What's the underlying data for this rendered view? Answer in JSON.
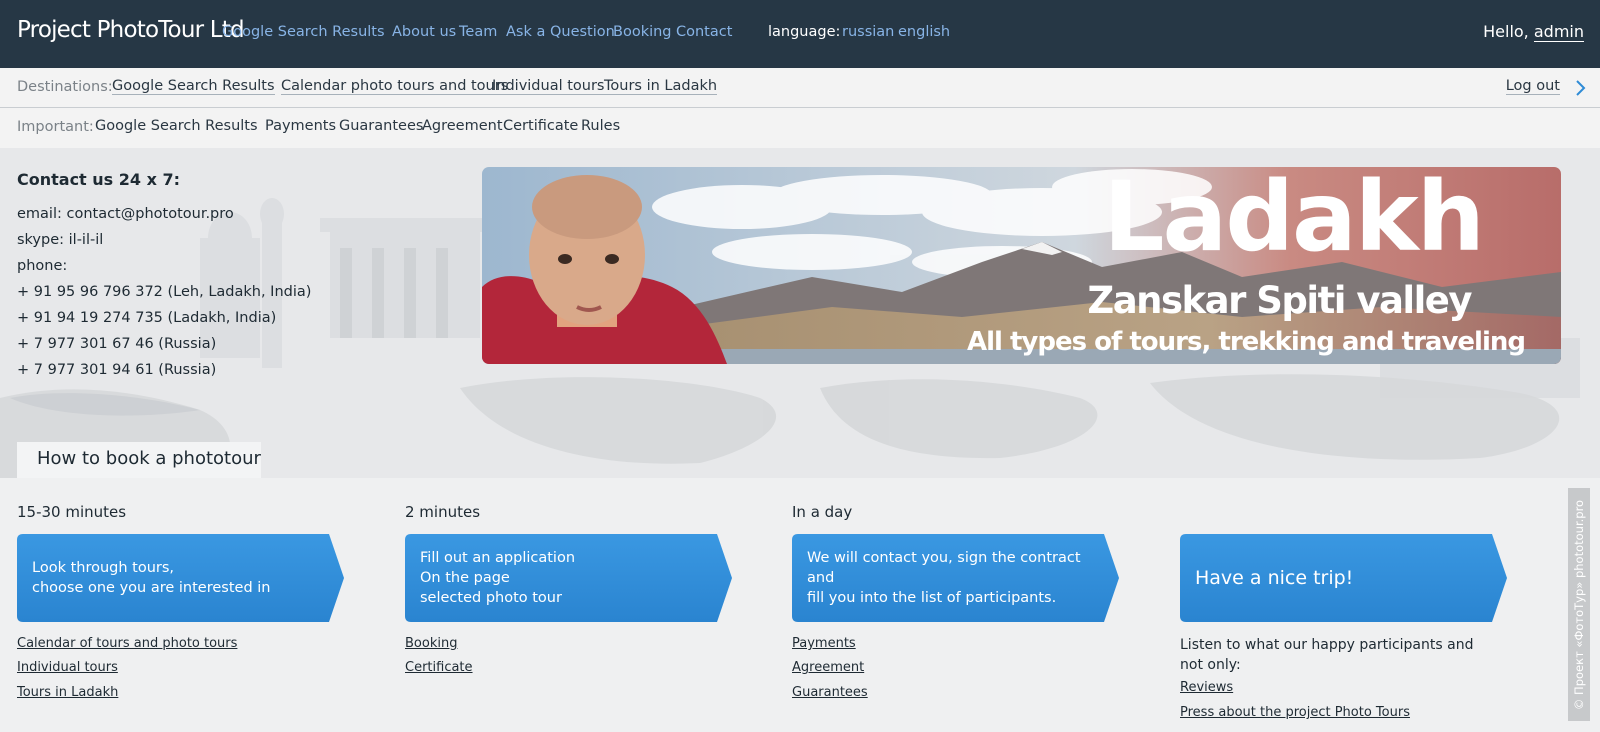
{
  "topbar": {
    "brand": "Project PhotoTour Ltd",
    "nav": [
      "Google Search Results",
      "About us",
      "Team",
      "Ask a Question",
      "Booking",
      "Contact"
    ],
    "language_label": "language:",
    "languages": [
      "russian",
      "english"
    ],
    "hello_prefix": "Hello,",
    "user": "admin"
  },
  "destinations": {
    "label": "Destinations:",
    "links": [
      "Google Search Results",
      "Calendar photo tours and tours",
      "Individual tours",
      "Tours in Ladakh"
    ],
    "logout": "Log out"
  },
  "important": {
    "label": "Important:",
    "links": [
      "Google Search Results",
      "Payments",
      "Guarantees",
      "Agreement",
      "Certificate",
      "Rules"
    ]
  },
  "contact": {
    "title": "Contact us 24 x 7:",
    "lines": [
      "email: contact@phototour.pro",
      "skype: il-il-il",
      "phone:",
      "+ 91 95 96 796 372 (Leh, Ladakh, India)",
      "+ 91 94 19 274 735 (Ladakh, India)",
      "+ 7 977 301 67 46 (Russia)",
      "+ 7 977 301 94 61 (Russia)"
    ]
  },
  "banner": {
    "title": "Ladakh",
    "subtitle": "Zanskar Spiti valley",
    "tagline": "All types of tours, trekking and traveling"
  },
  "booking": {
    "heading": "How to book a phototour",
    "steps": [
      {
        "time": "15-30 minutes",
        "text_lines": [
          "Look through tours,",
          "choose one you are interested in"
        ],
        "links": [
          "Calendar of tours and photo tours",
          "Individual tours",
          "Tours in Ladakh"
        ]
      },
      {
        "time": "2 minutes",
        "text_lines": [
          "Fill out an application",
          "On the page",
          "selected photo tour"
        ],
        "links": [
          "Booking",
          "Certificate"
        ]
      },
      {
        "time": "In a day",
        "text_lines": [
          "We will contact you, sign the contract and",
          "fill you into the list of participants."
        ],
        "links": [
          "Payments",
          "Agreement",
          "Guarantees"
        ]
      },
      {
        "time": "",
        "text_lines": [
          "Have a nice trip!"
        ],
        "note": "Listen to what our happy participants and not only:",
        "links": [
          "Reviews",
          "Press about the project Photo Tours"
        ]
      }
    ]
  },
  "watermark": "© Проект «ФотоТур» phototour.pro",
  "colors": {
    "topbar": "#263745",
    "link": "#88b4e6",
    "accent_blue": "#2f8bd6"
  }
}
